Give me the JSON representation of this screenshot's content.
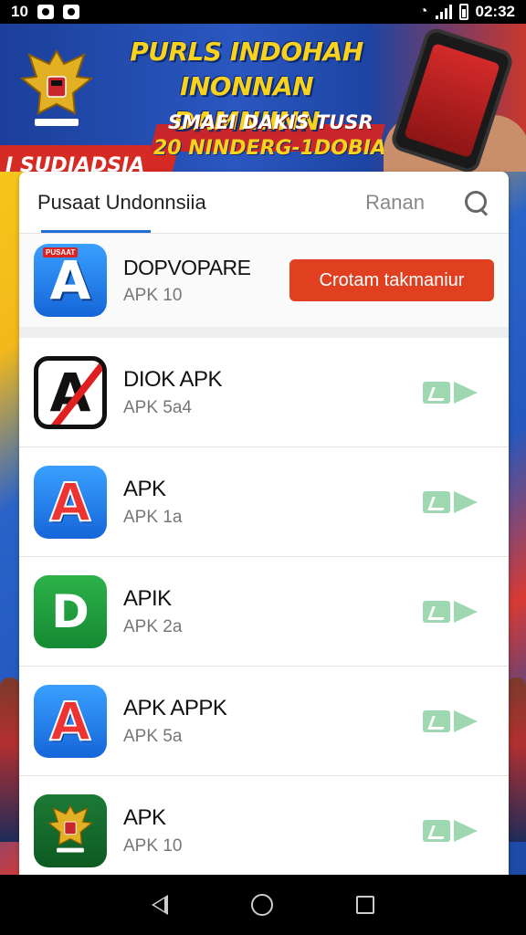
{
  "status_bar": {
    "left_number": "10",
    "time": "02:32"
  },
  "banner": {
    "title_line1": "PURLS INDOHAH",
    "title_line2": "INONNAN DAMNIINN",
    "subtitle_line1": "SMAEI DAKIS TUSR",
    "subtitle_line2": "20 NINDERG-1DOBIAI !",
    "left_label": "I SUDIADSIA"
  },
  "header": {
    "tab_main": "Pusaat Undonnsiia",
    "tab_secondary": "Ranan",
    "search_icon": "search-icon"
  },
  "featured": {
    "name": "DOPVOPARE",
    "meta": "APK 10",
    "icon_tag": "PUSAAT",
    "button_label": "Crotam takmaniur",
    "icon": "apk-a-icon",
    "button_color": "#e0401f"
  },
  "apps": [
    {
      "name": "DIOK APK",
      "meta": "APK 5a4",
      "icon": "apk-a-crossed-icon"
    },
    {
      "name": "APK",
      "meta": "APK 1a",
      "icon": "apk-a-red-icon"
    },
    {
      "name": "APIK",
      "meta": "APK 2a",
      "icon": "apk-green-d-icon"
    },
    {
      "name": "APK APPK",
      "meta": "APK 5a",
      "icon": "apk-a-red-icon"
    },
    {
      "name": "APK",
      "meta": "APK 10",
      "icon": "garuda-emblem-icon"
    }
  ],
  "colors": {
    "accent": "#1f6fd6",
    "download_action": "#9fd8b0"
  }
}
